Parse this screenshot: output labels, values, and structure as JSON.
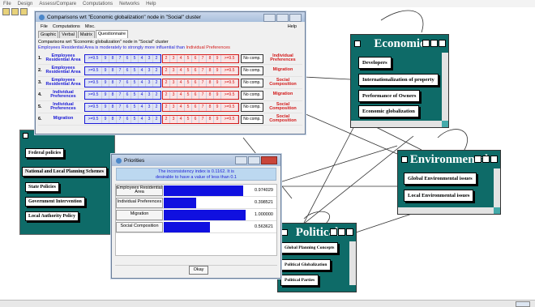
{
  "menubar": {
    "items": [
      "File",
      "Design",
      "Assess/Compare",
      "Computations",
      "Networks",
      "Help"
    ]
  },
  "comparisons": {
    "title": "Comparisons wrt \"Economic globalization\" node in \"Social\" cluster",
    "menu": {
      "file": "File",
      "computations": "Computations",
      "misc": "Misc.",
      "help": "Help"
    },
    "tabs": [
      "Graphic",
      "Verbal",
      "Matrix",
      "Questionnaire"
    ],
    "info_line1": "Comparisons wrt \"Economic globalization\" node in \"Social\" cluster",
    "info_line2_a": "Employees Residential Area is moderately to strongly more influential than ",
    "info_line2_b": "Individual Preferences",
    "scale_left": [
      ">=9.5",
      "9",
      "8",
      "7",
      "6",
      "5",
      "4",
      "3",
      "2"
    ],
    "scale_right": [
      "2",
      "3",
      "4",
      "5",
      "6",
      "7",
      "8",
      "9",
      ">=9.5"
    ],
    "no_comp": "No comp.",
    "rows": [
      {
        "num": "1.",
        "left": "Employees Residential Area",
        "right": "Individual Preferences"
      },
      {
        "num": "2.",
        "left": "Employees Residential Area",
        "right": "Migration"
      },
      {
        "num": "3.",
        "left": "Employees Residential Area",
        "right": "Social Composition"
      },
      {
        "num": "4.",
        "left": "Individual Preferences",
        "right": "Migration"
      },
      {
        "num": "5.",
        "left": "Individual Preferences",
        "right": "Social Composition"
      },
      {
        "num": "6.",
        "left": "Migration",
        "right": "Social Composition"
      }
    ]
  },
  "priorities": {
    "title": "Priorities",
    "inconsistency_line1": "The inconsistency index is 0.1162. It is",
    "inconsistency_line2": "desirable to have a value of less than 0.1",
    "rows": [
      {
        "label": "Employees Residential Area",
        "value": 0.974029,
        "text": "0.974029"
      },
      {
        "label": "Individual Preferences",
        "value": 0.398521,
        "text": "0.398521"
      },
      {
        "label": "Migration",
        "value": 1.0,
        "text": "1.000000"
      },
      {
        "label": "Social Composition",
        "value": 0.563621,
        "text": "0.563621"
      }
    ],
    "ok": "Okay"
  },
  "clusters": {
    "economic": {
      "title": "Economic",
      "nodes": [
        "Developers",
        "Internationalization of property",
        "Performance of Owners",
        "Economic globalization"
      ]
    },
    "environmental": {
      "title": "Environmental",
      "nodes": [
        "Global Environmental issues",
        "Local Environmental issues"
      ]
    },
    "political": {
      "title": "Political",
      "nodes": [
        "Global Planning Concepts",
        "Political Globalization",
        "Political Parties"
      ]
    },
    "government": {
      "nodes": [
        "Federal policies",
        "National and Local Planning Schemes",
        "State Policies",
        "Government Intervention",
        "Local Authority Policy"
      ]
    }
  },
  "colors": {
    "cluster_bg": "#0e6b68",
    "bar": "#1010e0",
    "blue_text": "#1b1bd6",
    "red_text": "#d31b1b"
  }
}
